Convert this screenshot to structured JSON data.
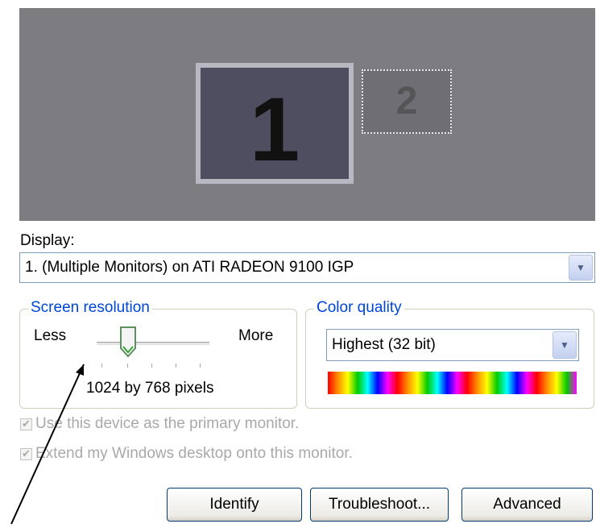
{
  "monitors": [
    {
      "number": "1"
    },
    {
      "number": "2"
    }
  ],
  "display": {
    "label": "Display:",
    "selected": "1. (Multiple Monitors) on ATI RADEON 9100 IGP"
  },
  "screen_resolution": {
    "title": "Screen resolution",
    "less_label": "Less",
    "more_label": "More",
    "value_text": "1024 by 768 pixels"
  },
  "color_quality": {
    "title": "Color quality",
    "selected": "Highest (32 bit)"
  },
  "checkboxes": [
    {
      "label": "Use this device as the primary monitor.",
      "checked": true,
      "enabled": false
    },
    {
      "label": "Extend my Windows desktop onto this monitor.",
      "checked": true,
      "enabled": false
    }
  ],
  "buttons": {
    "identify": "Identify",
    "troubleshoot": "Troubleshoot...",
    "advanced": "Advanced"
  },
  "colors": {
    "group_title": "#0046d5",
    "monitor_background": "#7d7c80",
    "disabled_text": "#a9a9a9"
  }
}
